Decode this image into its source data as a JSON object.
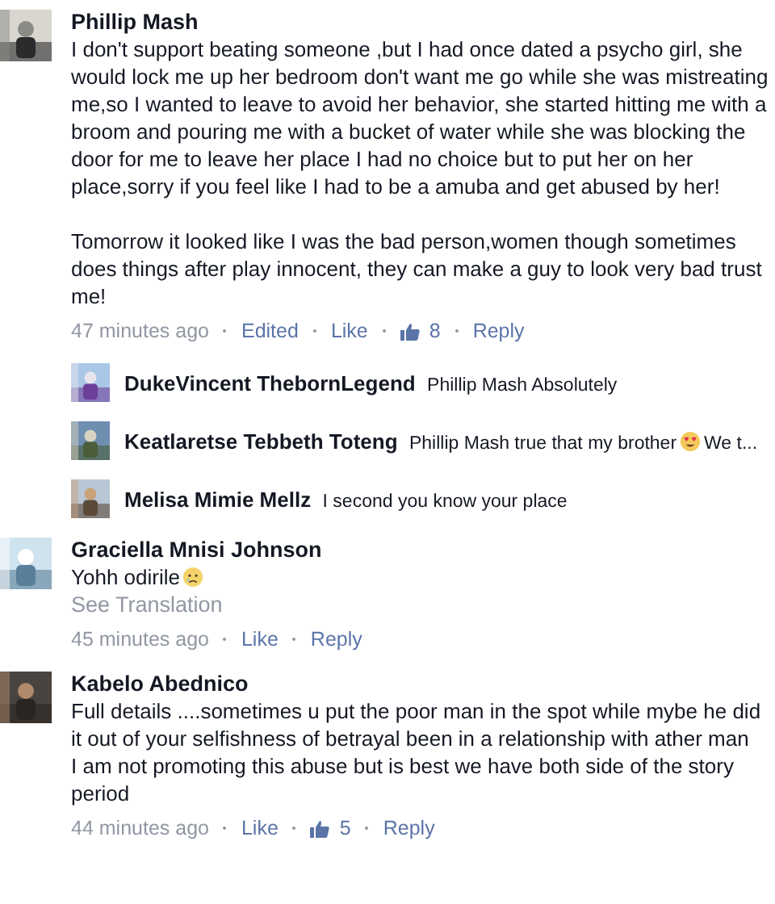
{
  "comments": [
    {
      "author": "Phillip Mash",
      "blocks": [
        [
          [
            {
              "kind": "text",
              "text": "I don't support beating someone ,but I had once dated a psycho girl, she would lock me up her bedroom don't want me go while she was mistreating me,so I wanted to leave to avoid her behavior, she started hitting me with a broom and pouring me with a bucket of water while she was blocking the door for me to leave her place I had no choice but to put her on her place,sorry if you feel like I had to be a amuba and get abused by her!"
            }
          ]
        ],
        [
          [
            {
              "kind": "text",
              "text": "Tomorrow it looked like I was the bad person,women though sometimes does things after play innocent, they can make a guy to look very bad trust me!"
            }
          ]
        ]
      ],
      "meta": {
        "time": "47 minutes ago",
        "edited": "Edited",
        "like": "Like",
        "likes": "8",
        "reply": "Reply"
      },
      "replies": [
        {
          "author": "DukeVincent ThebornLegend",
          "segments": [
            {
              "kind": "text",
              "text": "Phillip Mash Absolutely"
            }
          ]
        },
        {
          "author": "Keatlaretse Tebbeth Toteng",
          "segments": [
            {
              "kind": "text",
              "text": "Phillip Mash true that my brother"
            },
            {
              "kind": "hearteyes"
            },
            {
              "kind": "text",
              "text": "We t..."
            }
          ]
        },
        {
          "author": "Melisa Mimie Mellz",
          "segments": [
            {
              "kind": "text",
              "text": "I second you know your place"
            }
          ]
        }
      ]
    },
    {
      "author": "Graciella Mnisi Johnson",
      "blocks": [
        [
          [
            {
              "kind": "text",
              "text": "Yohh odirile"
            },
            {
              "kind": "tearface"
            }
          ]
        ]
      ],
      "translation": "See Translation",
      "meta": {
        "time": "45 minutes ago",
        "like": "Like",
        "reply": "Reply"
      }
    },
    {
      "author": "Kabelo Abednico",
      "blocks": [
        [
          [
            {
              "kind": "text",
              "text": "Full details  ....sometimes u put the poor man in the spot while mybe he did it out of your selfishness of betrayal been in a relationship with ather man"
            }
          ],
          [
            {
              "kind": "text",
              "text": "I am not promoting this abuse but is best we have both side of the story period"
            }
          ]
        ]
      ],
      "meta": {
        "time": "44 minutes ago",
        "like": "Like",
        "likes": "5",
        "reply": "Reply"
      }
    }
  ]
}
